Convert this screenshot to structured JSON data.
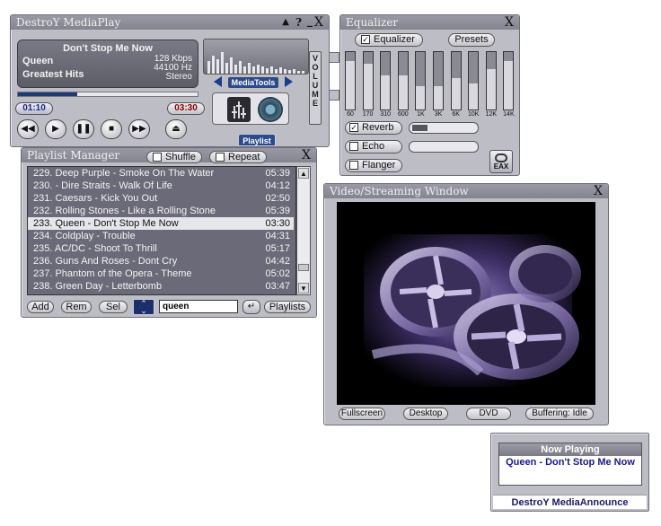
{
  "player": {
    "title": "DestroY MediaPlay",
    "controls": [
      "▲",
      "?",
      "_",
      "X"
    ],
    "song": "Don't Stop Me Now",
    "artist": "Queen",
    "album": "Greatest Hits",
    "bitrate": "128 Kbps",
    "samplerate": "44100 Hz",
    "channels": "Stereo",
    "elapsed": "01:10",
    "remaining": "03:30",
    "progress": 0.33,
    "mediatools_label": "MediaTools",
    "volume_label": "VOLUME",
    "playlist_tab": "Playlist"
  },
  "equalizer": {
    "title": "Equalizer",
    "enabled_label": "Equalizer",
    "presets_label": "Presets",
    "bands": [
      {
        "label": "60",
        "level": 0.85
      },
      {
        "label": "170",
        "level": 0.8
      },
      {
        "label": "310",
        "level": 0.6
      },
      {
        "label": "600",
        "level": 0.6
      },
      {
        "label": "1K",
        "level": 0.4
      },
      {
        "label": "3K",
        "level": 0.4
      },
      {
        "label": "6K",
        "level": 0.55
      },
      {
        "label": "10K",
        "level": 0.45
      },
      {
        "label": "12K",
        "level": 0.7
      },
      {
        "label": "14K",
        "level": 0.85
      }
    ],
    "reverb_label": "Reverb",
    "reverb_checked": true,
    "reverb_level": 0.22,
    "echo_label": "Echo",
    "flanger_label": "Flanger",
    "eax_label": "EAX"
  },
  "playlist": {
    "title": "Playlist Manager",
    "shuffle_label": "Shuffle",
    "repeat_label": "Repeat",
    "items": [
      {
        "num": "229.",
        "name": "Deep Purple - Smoke On The Water",
        "dur": "05:39"
      },
      {
        "num": "230.",
        "name": " - Dire Straits - Walk Of Life",
        "dur": "04:12"
      },
      {
        "num": "231.",
        "name": "Caesars - Kick You Out",
        "dur": "02:50"
      },
      {
        "num": "232.",
        "name": "Rolling Stones - Like a Rolling Stone",
        "dur": "05:39"
      },
      {
        "num": "233.",
        "name": "Queen - Don't Stop Me Now",
        "dur": "03:30"
      },
      {
        "num": "234.",
        "name": "Coldplay - Trouble",
        "dur": "04:31"
      },
      {
        "num": "235.",
        "name": "AC/DC - Shoot To Thrill",
        "dur": "05:17"
      },
      {
        "num": "236.",
        "name": "Guns And Roses - Dont Cry",
        "dur": "04:42"
      },
      {
        "num": "237.",
        "name": "Phantom of the Opera - Theme",
        "dur": "05:02"
      },
      {
        "num": "238.",
        "name": "Green Day - Letterbomb",
        "dur": "03:47"
      }
    ],
    "selected_index": 4,
    "add_label": "Add",
    "rem_label": "Rem",
    "sel_label": "Sel",
    "search_value": "queen",
    "playlists_label": "Playlists"
  },
  "video": {
    "title": "Video/Streaming Window",
    "fullscreen_label": "Fullscreen",
    "desktop_label": "Desktop",
    "dvd_label": "DVD",
    "status": "Buffering: Idle"
  },
  "announce": {
    "heading": "Now Playing",
    "text": "Queen - Don't Stop Me Now",
    "footer": "DestroY MediaAnnounce"
  }
}
